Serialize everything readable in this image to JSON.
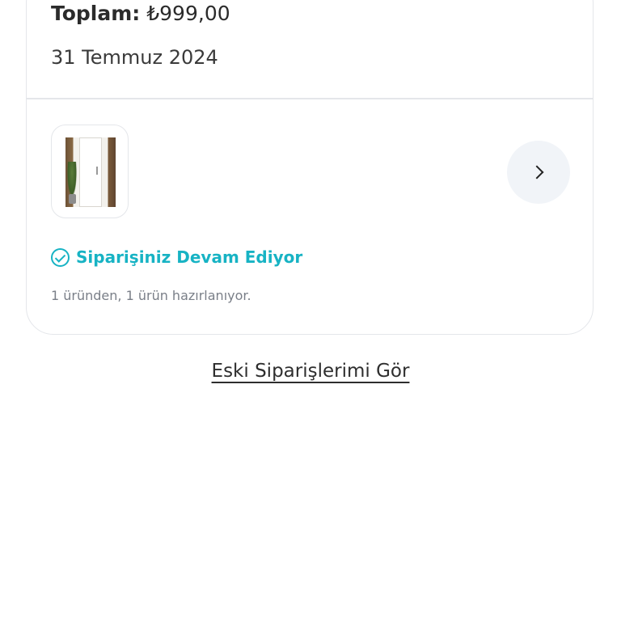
{
  "order": {
    "total_label": "Toplam:",
    "total_value": "₺999,00",
    "date": "31 Temmuz 2024",
    "product_image_icon": "wardrobe-product-thumbnail",
    "detail_icon": "chevron-right-icon",
    "status": "Siparişiniz Devam Ediyor",
    "status_icon": "check-circle-icon",
    "status_color": "#17b3c4",
    "status_detail": "1 üründen, 1 ürün hazırlanıyor."
  },
  "old_orders_link": "Eski Siparişlerimi Gör"
}
